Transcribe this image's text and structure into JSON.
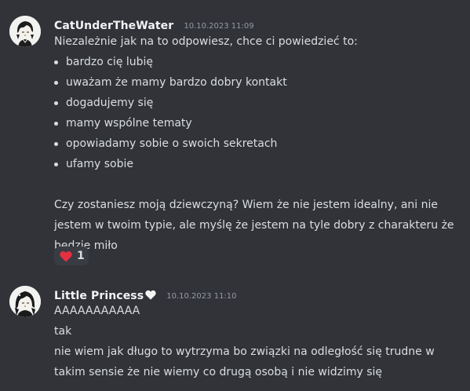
{
  "messages": [
    {
      "username": "CatUnderTheWater",
      "timestamp": "10.10.2023 11:09",
      "avatar_icon": "anime-boy-avatar-icon",
      "intro": "Niezależnie jak na to odpowiesz, chce ci powiedzieć to:",
      "bullets": [
        "bardzo cię lubię",
        "uważam że mamy bardzo dobry kontakt",
        "dogadujemy się",
        "mamy wspólne tematy",
        "opowiadamy sobie o swoich sekretach",
        "ufamy sobie"
      ],
      "paragraph_lines": [
        "Czy zostaniesz moją dziewczyną? Wiem że nie jestem idealny, ani nie",
        "jestem w twoim typie, ale myślę że jestem na tyle dobry z charakteru że",
        "będzie miło"
      ],
      "reaction": {
        "emoji_icon": "red-heart-icon",
        "count": "1"
      }
    },
    {
      "username": "Little Princess",
      "username_badge_icon": "white-heart-icon",
      "timestamp": "10.10.2023 11:10",
      "avatar_icon": "anime-girl-avatar-icon",
      "lines": [
        "AAAAAAAAAAA",
        "tak",
        "nie wiem jak długo to wytrzyma bo związki na odległość się trudne w",
        "takim sensie że nie wiemy co drugą osobą i nie widzimy się"
      ]
    }
  ],
  "colors": {
    "background": "#313338",
    "text": "#dbdee1",
    "username": "#f2f3f5",
    "timestamp": "#949ba4",
    "reaction_bg": "#393c43",
    "heart": "#e5303f"
  }
}
